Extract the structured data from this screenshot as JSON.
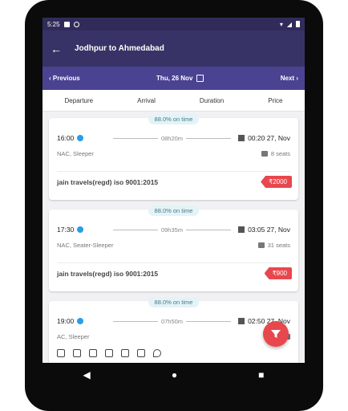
{
  "status": {
    "time": "5:25"
  },
  "appbar": {
    "title": "Jodhpur to Ahmedabad"
  },
  "datebar": {
    "prev": "Previous",
    "date": "Thu, 26 Nov",
    "next": "Next"
  },
  "sort": {
    "departure": "Departure",
    "arrival": "Arrival",
    "duration": "Duration",
    "price": "Price"
  },
  "cards": [
    {
      "ontime": "88.0% on time",
      "dep": "16:00",
      "dur": "08h20m",
      "arr": "00:20 27, Nov",
      "type": "NAC, Sleeper",
      "seats": "8 seats",
      "operator": "jain travels(regd) iso 9001:2015",
      "price": "₹2000"
    },
    {
      "ontime": "88.0% on time",
      "dep": "17:30",
      "dur": "09h35m",
      "arr": "03:05 27, Nov",
      "type": "NAC, Seater-Sleeper",
      "seats": "31 seats",
      "operator": "jain travels(regd) iso 9001:2015",
      "price": "₹900"
    },
    {
      "ontime": "88.0% on time",
      "dep": "19:00",
      "dur": "07h50m",
      "arr": "02:50 27, Nov",
      "type": "AC, Sleeper",
      "seats": ""
    }
  ],
  "colors": {
    "accent": "#e8474d",
    "header": "#383366",
    "datebar": "#4a4391"
  }
}
